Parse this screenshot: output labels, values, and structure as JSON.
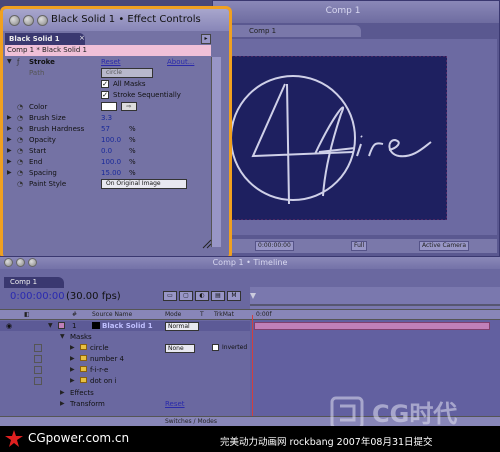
{
  "comp_window": {
    "title": "Comp 1",
    "tab_label": "Comp 1",
    "timecode": "0:00:00:00",
    "resolution": "Full",
    "camera": "Active Camera"
  },
  "effect_controls": {
    "title": "Black Solid 1 • Effect Controls",
    "tab_label": "Black Solid 1",
    "comp_path": "Comp 1 * Black Solid 1",
    "effect_name": "Stroke",
    "reset_label": "Reset",
    "about_label": "About...",
    "path_label": "Path",
    "path_value": "circle",
    "all_masks_label": "All Masks",
    "stroke_seq_label": "Stroke Sequentially",
    "color_label": "Color",
    "params": [
      {
        "label": "Brush Size",
        "value": "3.3",
        "unit": ""
      },
      {
        "label": "Brush Hardness",
        "value": "57",
        "unit": "%"
      },
      {
        "label": "Opacity",
        "value": "100.0",
        "unit": "%"
      },
      {
        "label": "Start",
        "value": "0.0",
        "unit": "%"
      },
      {
        "label": "End",
        "value": "100.0",
        "unit": "%"
      },
      {
        "label": "Spacing",
        "value": "15.00",
        "unit": "%"
      }
    ],
    "paint_style_label": "Paint Style",
    "paint_style_value": "On Original Image"
  },
  "timeline": {
    "title": "Comp 1 • Timeline",
    "tab_label": "Comp 1",
    "current_time": "0:00:00:00",
    "fps": "(30.00 fps)",
    "ruler_start": "0:00f",
    "columns": {
      "source_name": "Source Name",
      "mode": "Mode",
      "t": "T",
      "trkmat": "TrkMat"
    },
    "layer": {
      "index": "1",
      "name": "Black Solid 1",
      "mode": "Normal"
    },
    "masks_label": "Masks",
    "masks": [
      {
        "name": "circle",
        "mode": "None",
        "invert": "Inverted"
      },
      {
        "name": "number 4"
      },
      {
        "name": "f-i-r-e"
      },
      {
        "name": "dot on i"
      }
    ],
    "effects_label": "Effects",
    "transform_label": "Transform",
    "transform_reset": "Reset",
    "switches_modes": "Switches / Modes"
  },
  "banner": {
    "site": "CGpower.com.cn",
    "caption": "完美动力动画网 rockbang 2007年08月31日提交",
    "watermark": "CG时代"
  },
  "colors": {
    "highlight": "#f0a020",
    "solid": "#1e2060",
    "layer_bar": "#c080b8"
  }
}
